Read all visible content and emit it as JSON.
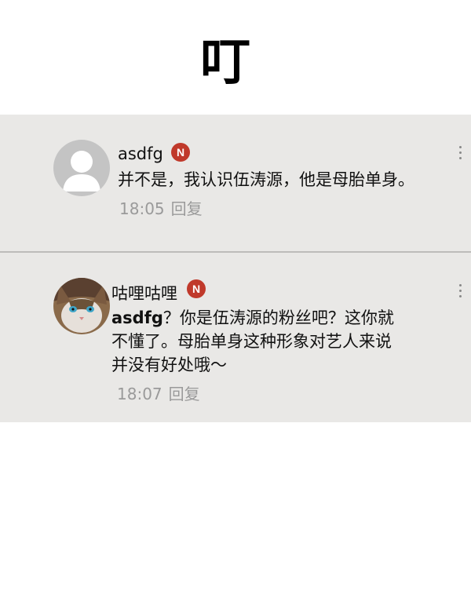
{
  "sfx_text": "叮",
  "comments": [
    {
      "username": "asdfg",
      "badge": "N",
      "text": "并不是，我认识伍涛源，他是母胎单身。",
      "time": "18:05",
      "reply_label": "回复",
      "avatar_icon": "default-user-avatar"
    },
    {
      "username": "咕哩咕哩",
      "badge": "N",
      "mention": "asdfg",
      "text_line1": "？你是伍涛源的粉丝吧？这你就",
      "text_line2": "不懂了。母胎单身这种形象对艺人来说",
      "text_line3": "并没有好处哦～",
      "time": "18:07",
      "reply_label": "回复",
      "avatar_icon": "cat-photo-avatar"
    }
  ],
  "colors": {
    "panel_bg": "#e9e8e6",
    "badge": "#c0392b",
    "meta_text": "#9a9a9a"
  }
}
